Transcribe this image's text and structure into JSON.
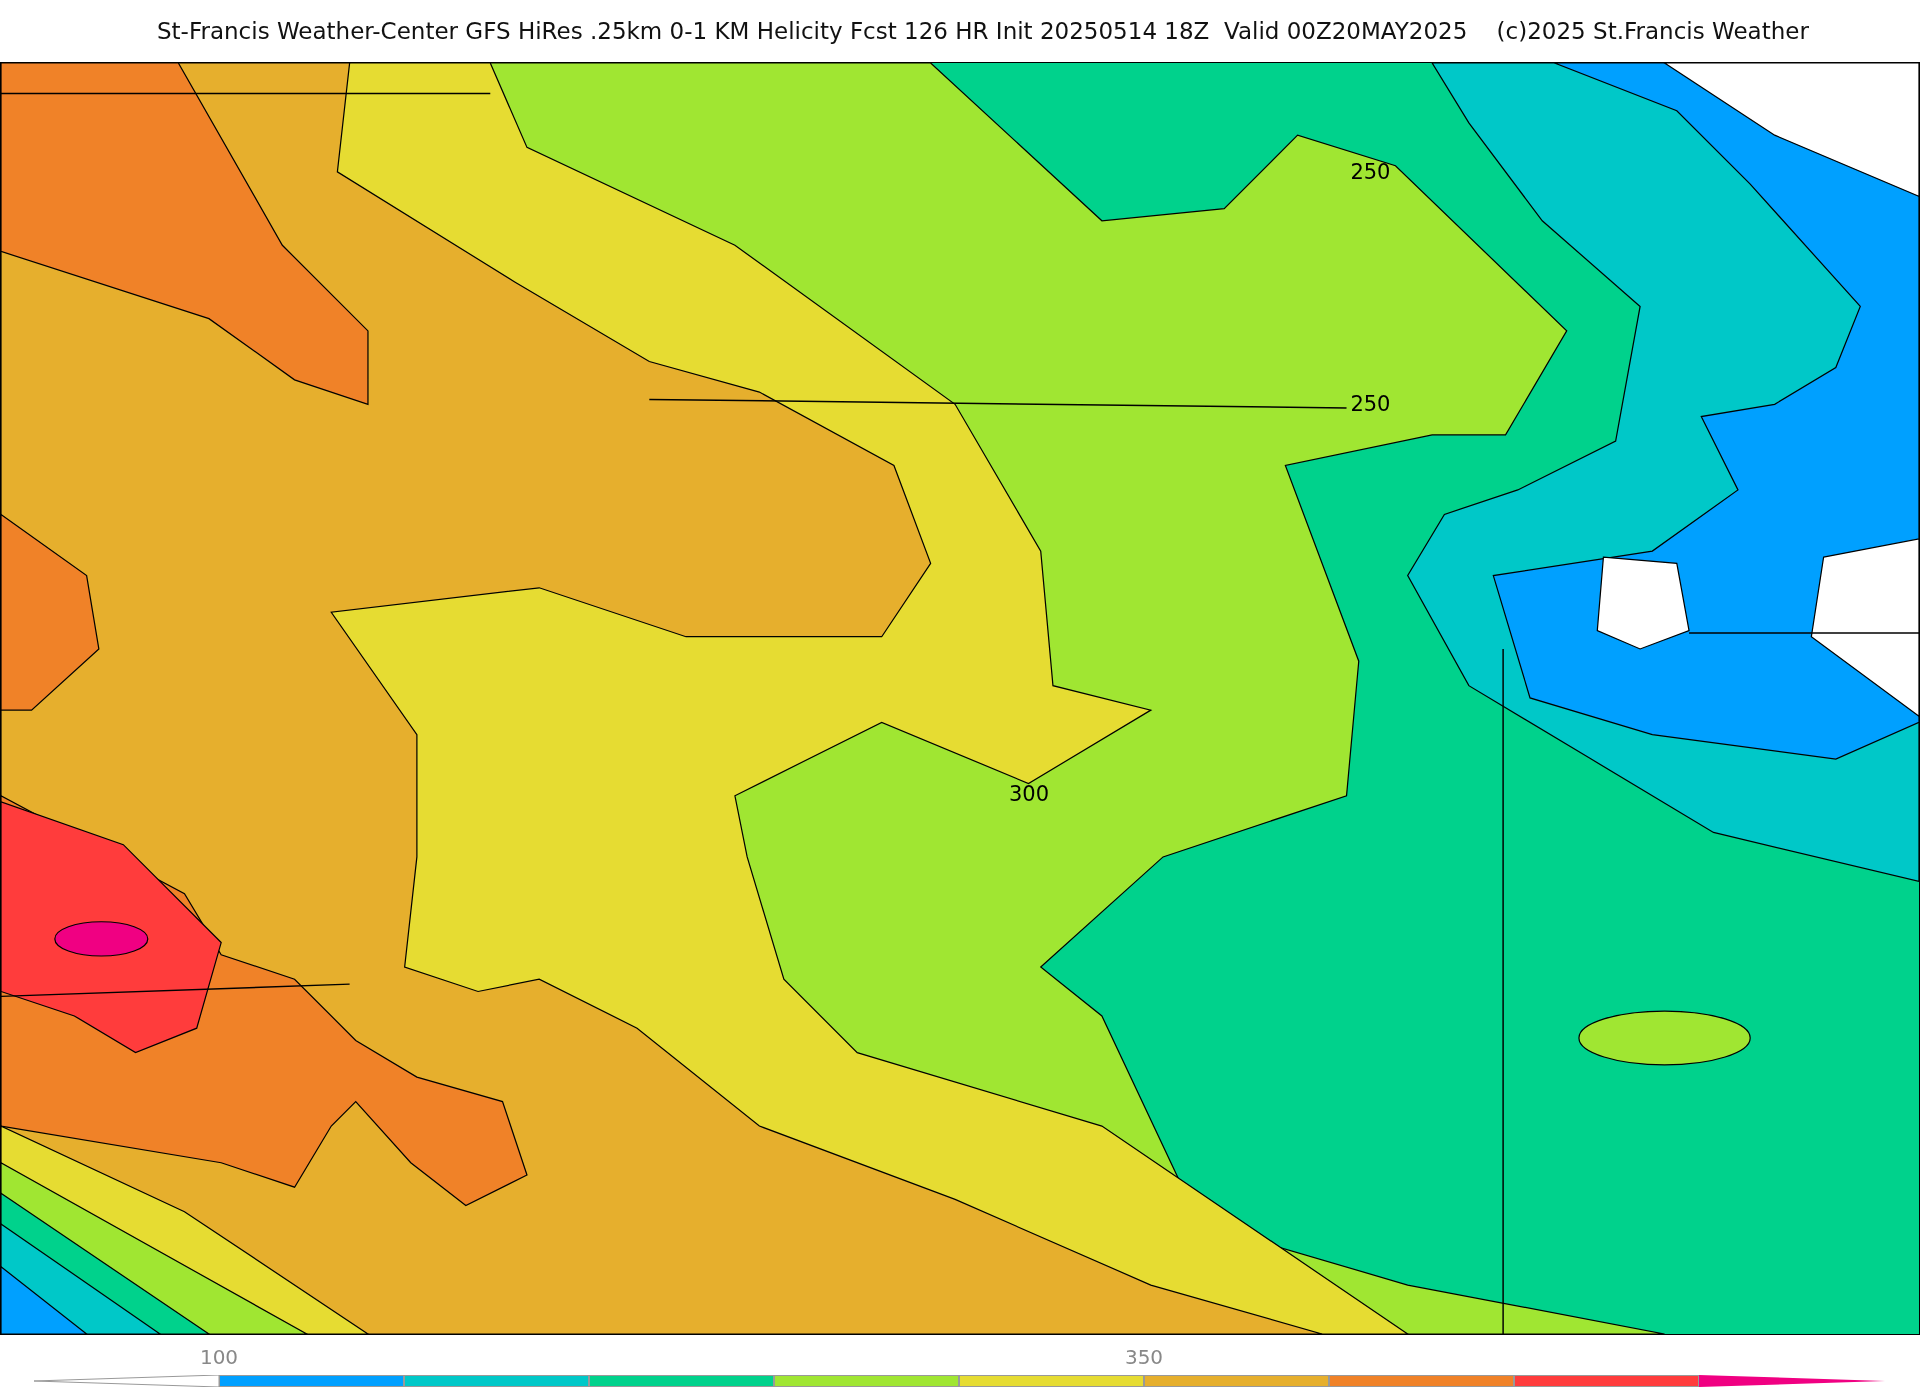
{
  "title": "St-Francis Weather-Center GFS HiRes .25km 0-1 KM Helicity Fcst 126 HR Init 20250514 18Z  Valid 00Z20MAY2025    (c)2025 St.Francis Weather",
  "map": {
    "contour_labels": [
      "250",
      "250",
      "300"
    ]
  },
  "colorbar": {
    "segments": [
      {
        "color": "#00a0ff",
        "label": "100"
      },
      {
        "color": "#00c8c8"
      },
      {
        "color": "#00d28c"
      },
      {
        "color": "#a0e632"
      },
      {
        "color": "#e6dc32"
      },
      {
        "color": "#e6af2d",
        "label": "350"
      },
      {
        "color": "#f08228"
      },
      {
        "color": "#ff3c3c"
      }
    ]
  }
}
